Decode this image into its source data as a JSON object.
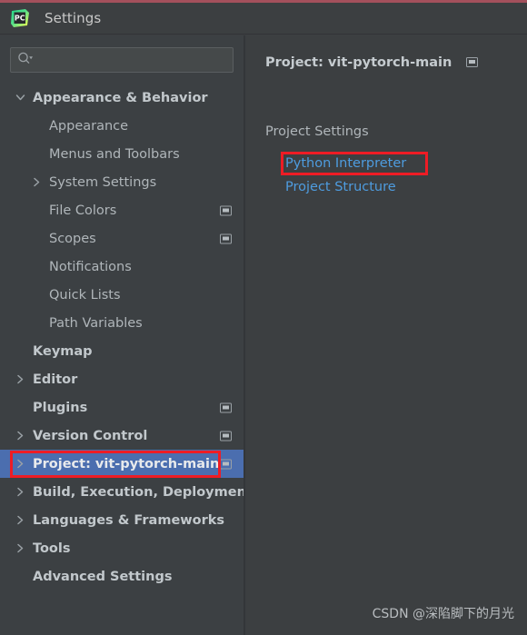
{
  "window": {
    "title": "Settings",
    "logo_icon": "pycharm-logo-icon",
    "accent_top_border": "#a4505c"
  },
  "search": {
    "value": "",
    "placeholder": "",
    "icon": "search-icon",
    "dropdown_icon": "triangle-down-icon"
  },
  "colors": {
    "selection_blue": "#4b6eaf",
    "link_blue": "#4e9cdf",
    "annotation_red": "#ee1c25",
    "panel_bg": "#3c3f41",
    "sidebar_bg": "#3c4043"
  },
  "sidebar": {
    "items": [
      {
        "label": "Appearance & Behavior",
        "level": 0,
        "chevron": "chevron-down-icon",
        "badge": false,
        "selected": false
      },
      {
        "label": "Appearance",
        "level": 1,
        "chevron": "",
        "badge": false,
        "selected": false
      },
      {
        "label": "Menus and Toolbars",
        "level": 1,
        "chevron": "",
        "badge": false,
        "selected": false
      },
      {
        "label": "System Settings",
        "level": 1,
        "chevron": "chevron-right-icon",
        "badge": false,
        "selected": false
      },
      {
        "label": "File Colors",
        "level": 1,
        "chevron": "",
        "badge": true,
        "selected": false
      },
      {
        "label": "Scopes",
        "level": 1,
        "chevron": "",
        "badge": true,
        "selected": false
      },
      {
        "label": "Notifications",
        "level": 1,
        "chevron": "",
        "badge": false,
        "selected": false
      },
      {
        "label": "Quick Lists",
        "level": 1,
        "chevron": "",
        "badge": false,
        "selected": false
      },
      {
        "label": "Path Variables",
        "level": 1,
        "chevron": "",
        "badge": false,
        "selected": false
      },
      {
        "label": "Keymap",
        "level": 0,
        "chevron": "",
        "badge": false,
        "selected": false
      },
      {
        "label": "Editor",
        "level": 0,
        "chevron": "chevron-right-icon",
        "badge": false,
        "selected": false
      },
      {
        "label": "Plugins",
        "level": 0,
        "chevron": "",
        "badge": true,
        "selected": false
      },
      {
        "label": "Version Control",
        "level": 0,
        "chevron": "chevron-right-icon",
        "badge": true,
        "selected": false
      },
      {
        "label": "Project: vit-pytorch-main",
        "level": 0,
        "chevron": "chevron-right-icon",
        "badge": true,
        "selected": true
      },
      {
        "label": "Build, Execution, Deployment",
        "level": 0,
        "chevron": "chevron-right-icon",
        "badge": false,
        "selected": false
      },
      {
        "label": "Languages & Frameworks",
        "level": 0,
        "chevron": "chevron-right-icon",
        "badge": false,
        "selected": false
      },
      {
        "label": "Tools",
        "level": 0,
        "chevron": "chevron-right-icon",
        "badge": false,
        "selected": false
      },
      {
        "label": "Advanced Settings",
        "level": 0,
        "chevron": "",
        "badge": false,
        "selected": false
      }
    ]
  },
  "main": {
    "header_title": "Project: vit-pytorch-main",
    "header_badge_icon": "module-badge-icon",
    "section_title": "Project Settings",
    "links": [
      {
        "label": "Python Interpreter",
        "highlighted": true
      },
      {
        "label": "Project Structure",
        "highlighted": false
      }
    ]
  },
  "watermark": {
    "text": "CSDN @深陷脚下的月光"
  }
}
